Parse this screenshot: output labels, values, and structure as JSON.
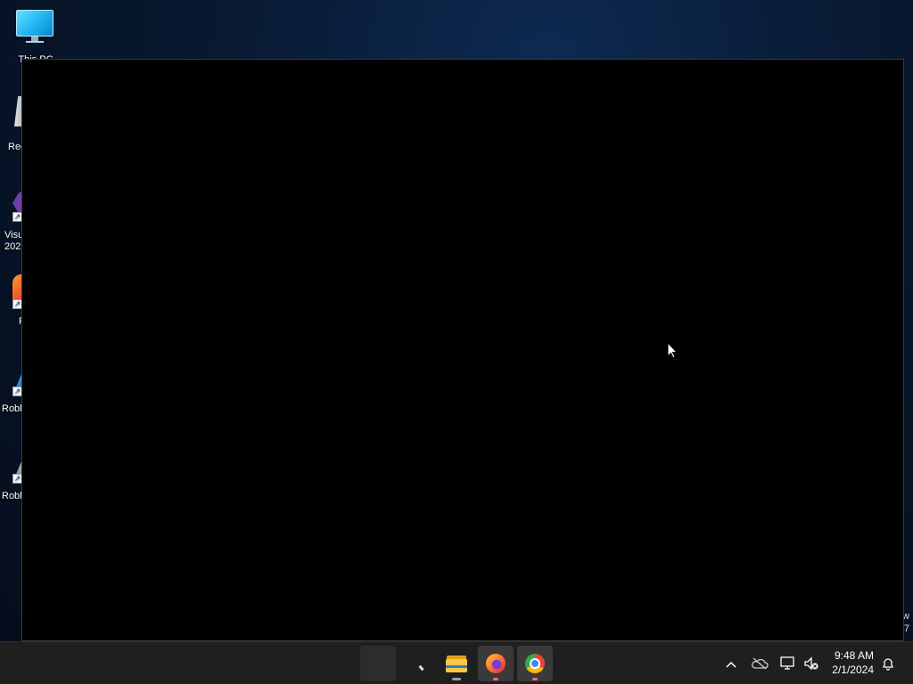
{
  "desktop": {
    "icons": [
      {
        "label": "This PC"
      },
      {
        "label": "Rec"
      },
      {
        "label": "Visu",
        "label2": "202"
      },
      {
        "label": "F"
      },
      {
        "label": "Robl"
      },
      {
        "label": "Robl"
      }
    ],
    "edge_text_1": "w",
    "edge_text_2": "7"
  },
  "taskbar": {
    "apps": [
      {
        "name": "blank-app"
      },
      {
        "name": "pen-app"
      },
      {
        "name": "file-explorer"
      },
      {
        "name": "firefox"
      },
      {
        "name": "chrome"
      }
    ],
    "tray": {
      "chevron": "^",
      "time": "9:48 AM",
      "date": "2/1/2024"
    }
  }
}
